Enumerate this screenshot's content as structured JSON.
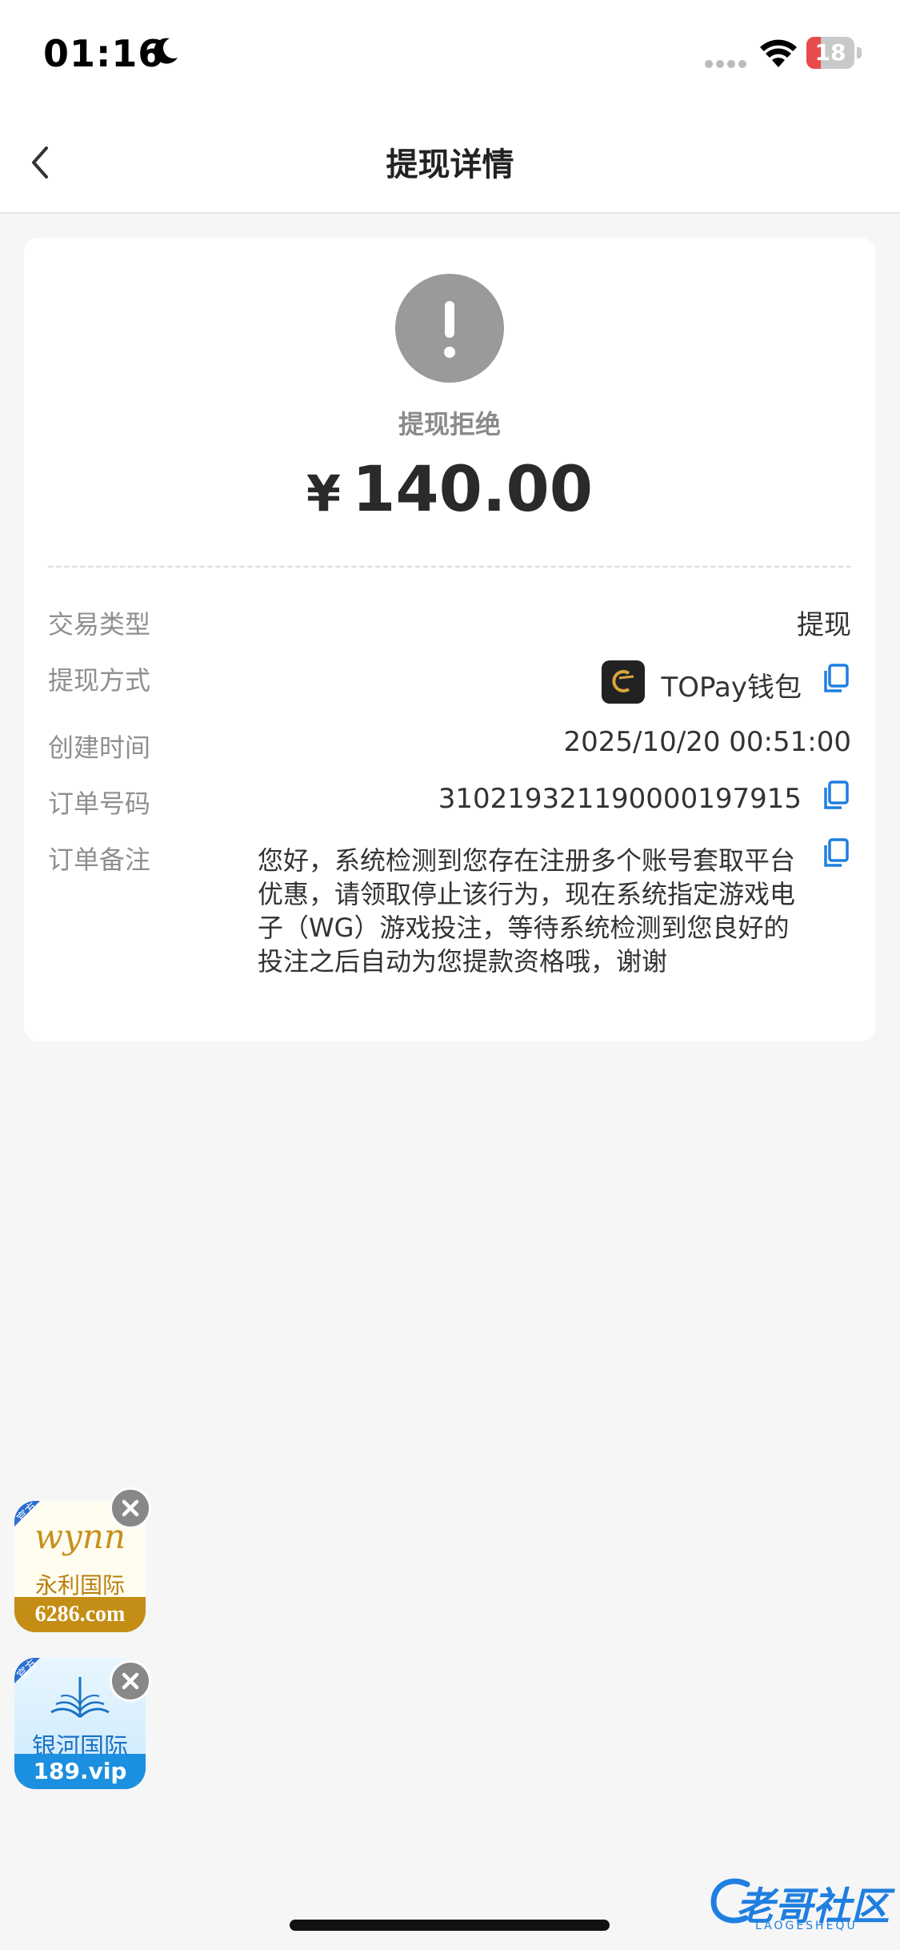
{
  "status_bar": {
    "time": "01:16",
    "battery_level": "18",
    "battery_color": "#e84b4b"
  },
  "nav": {
    "title": "提现详情"
  },
  "status": {
    "text": "提现拒绝",
    "icon": "exclamation-icon"
  },
  "amount": {
    "currency": "¥",
    "value": "140.00"
  },
  "details": {
    "type_label": "交易类型",
    "type_value": "提现",
    "method_label": "提现方式",
    "method_value": "TOPay钱包",
    "created_label": "创建时间",
    "created_value": "2025/10/20 00:51:00",
    "order_label": "订单号码",
    "order_value": "310219321190000197915",
    "remark_label": "订单备注",
    "remark_value": "您好，系统检测到您存在注册多个账号套取平台优惠，请领取停止该行为，现在系统指定游戏电子（WG）游戏投注，等待系统检测到您良好的投注之后自动为您提款资格哦，谢谢"
  },
  "ads": [
    {
      "badge": "官方",
      "script": "wynn",
      "name": "永利国际",
      "site": "6286.com"
    },
    {
      "badge": "官方",
      "name": "银河国际",
      "site": "189.vip"
    }
  ],
  "watermark": {
    "text": "老哥社区",
    "sub": "LAOGESHEQU"
  },
  "accent_color": "#1f7fe0"
}
